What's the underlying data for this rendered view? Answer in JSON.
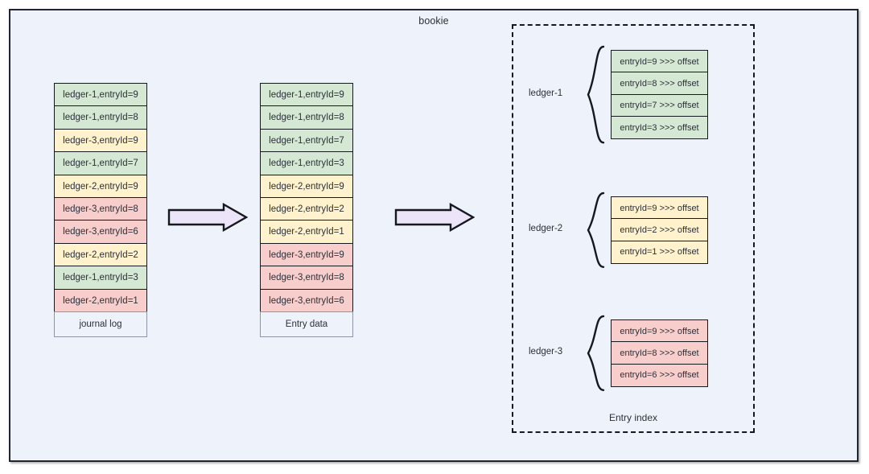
{
  "diagram": {
    "title": "bookie",
    "palette": {
      "canvas": "#eef2fa",
      "outline": "#1f2430",
      "ledger_1": "#d5e8d4",
      "ledger_2": "#fff2cc",
      "ledger_3": "#f8cecc",
      "arrow_fill": "#ece4f8",
      "arrow_stroke": "#15181d",
      "text": "#2b3038"
    },
    "journal_log": {
      "footer_label": "journal log",
      "rows": [
        {
          "label": "ledger-1,entryId=9",
          "color_class": "green"
        },
        {
          "label": "ledger-1,entryId=8",
          "color_class": "green"
        },
        {
          "label": "ledger-3,entryId=9",
          "color_class": "yellow"
        },
        {
          "label": "ledger-1,entryId=7",
          "color_class": "green"
        },
        {
          "label": "ledger-2,entryId=9",
          "color_class": "yellow"
        },
        {
          "label": "ledger-3,entryId=8",
          "color_class": "pink"
        },
        {
          "label": "ledger-3,entryId=6",
          "color_class": "pink"
        },
        {
          "label": "ledger-2,entryId=2",
          "color_class": "yellow"
        },
        {
          "label": "ledger-1,entryId=3",
          "color_class": "green"
        },
        {
          "label": "ledger-2,entryId=1",
          "color_class": "pink"
        }
      ]
    },
    "entry_data": {
      "footer_label": "Entry data",
      "rows": [
        {
          "label": "ledger-1,entryId=9",
          "color_class": "green"
        },
        {
          "label": "ledger-1,entryId=8",
          "color_class": "green"
        },
        {
          "label": "ledger-1,entryId=7",
          "color_class": "green"
        },
        {
          "label": "ledger-1,entryId=3",
          "color_class": "green"
        },
        {
          "label": "ledger-2,entryId=9",
          "color_class": "yellow"
        },
        {
          "label": "ledger-2,entryId=2",
          "color_class": "yellow"
        },
        {
          "label": "ledger-2,entryId=1",
          "color_class": "yellow"
        },
        {
          "label": "ledger-3,entryId=9",
          "color_class": "pink"
        },
        {
          "label": "ledger-3,entryId=8",
          "color_class": "pink"
        },
        {
          "label": "ledger-3,entryId=6",
          "color_class": "pink"
        }
      ]
    },
    "entry_index": {
      "footer_label": "Entry index",
      "groups": [
        {
          "ledger_label": "ledger-1",
          "color_class": "green",
          "entries": [
            "entryId=9 >>> offset",
            "entryId=8 >>> offset",
            "entryId=7 >>> offset",
            "entryId=3 >>> offset"
          ]
        },
        {
          "ledger_label": "ledger-2",
          "color_class": "yellow",
          "entries": [
            "entryId=9 >>> offset",
            "entryId=2 >>> offset",
            "entryId=1 >>> offset"
          ]
        },
        {
          "ledger_label": "ledger-3",
          "color_class": "pink",
          "entries": [
            "entryId=9 >>> offset",
            "entryId=8 >>> offset",
            "entryId=6 >>> offset"
          ]
        }
      ]
    },
    "arrows": [
      {
        "name": "arrow-journal-to-entry-data"
      },
      {
        "name": "arrow-entry-data-to-entry-index"
      }
    ]
  }
}
